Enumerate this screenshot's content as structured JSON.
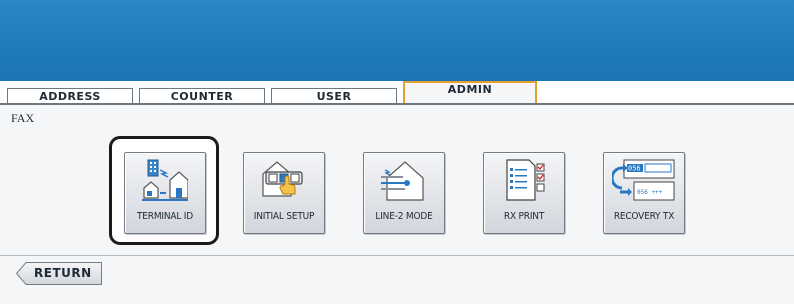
{
  "tabs": [
    {
      "label": "ADDRESS",
      "active": false
    },
    {
      "label": "COUNTER",
      "active": false
    },
    {
      "label": "USER",
      "active": false
    },
    {
      "label": "ADMIN",
      "active": true
    }
  ],
  "section": {
    "label": "FAX"
  },
  "buttons": [
    {
      "label": "TERMINAL ID",
      "icon": "terminal-id-icon",
      "selected": true
    },
    {
      "label": "INITIAL SETUP",
      "icon": "initial-setup-icon",
      "selected": false
    },
    {
      "label": "LINE-2 MODE",
      "icon": "line-2-mode-icon",
      "selected": false
    },
    {
      "label": "RX PRINT",
      "icon": "rx-print-icon",
      "selected": false
    },
    {
      "label": "RECOVERY TX",
      "icon": "recovery-tx-icon",
      "selected": false
    }
  ],
  "return_label": "RETURN",
  "icon_text": {
    "recovery_line1": "056",
    "recovery_line2": "056 +++"
  },
  "colors": {
    "header_blue": "#1f7bb9",
    "active_tab_border": "#e6a032",
    "panel_bg": "#f5f6f8",
    "icon_blue": "#2a78c2"
  }
}
